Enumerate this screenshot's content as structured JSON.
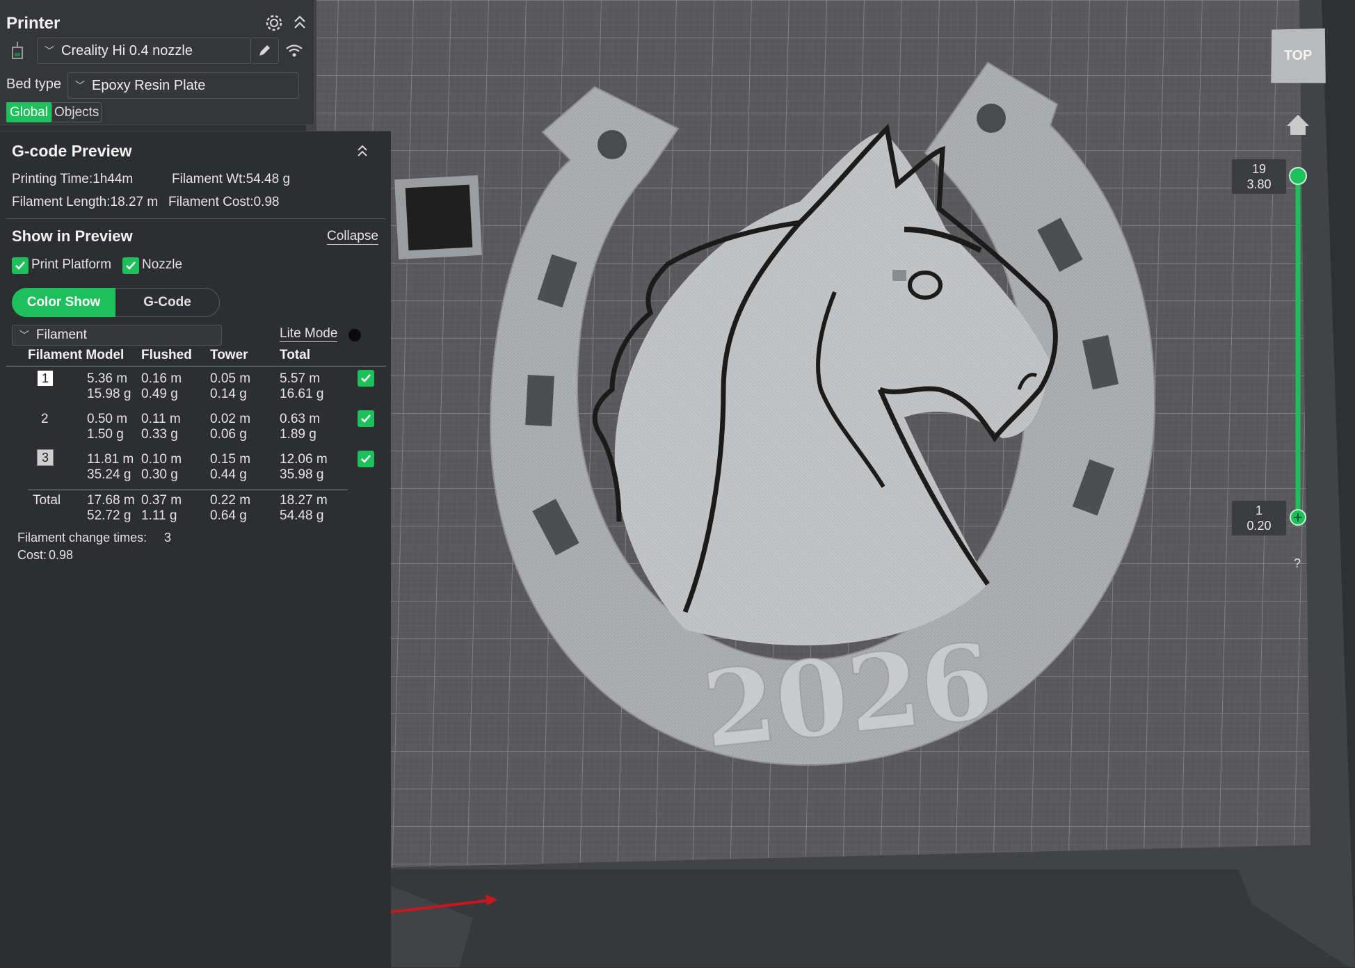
{
  "printer": {
    "title": "Printer",
    "printer_name": "Creality Hi 0.4 nozzle",
    "bed_type_label": "Bed type",
    "bed_type": "Epoxy Resin Plate",
    "tabs": [
      "Global",
      "Objects"
    ],
    "icons": [
      "printer-icon",
      "gear-icon",
      "collapse-up-icon",
      "edit-pencil-icon",
      "wifi-icon"
    ]
  },
  "gcode": {
    "title": "G-code Preview",
    "printing_time": "Printing Time:1h44m",
    "filament_wt": "Filament Wt:54.48 g",
    "filament_length": "Filament Length:18.27 m",
    "filament_cost": "Filament Cost:0.98",
    "show_in_preview": "Show in Preview",
    "collapse": "Collapse",
    "print_platform": "Print Platform",
    "nozzle": "Nozzle",
    "color_show": "Color Show",
    "gcode_tab": "G-Code",
    "filament_dropdown": "Filament",
    "lite_mode": "Lite Mode",
    "columns": [
      "Filament Model",
      "Flushed",
      "Tower",
      "Total"
    ],
    "rows": [
      {
        "id": "1",
        "model": [
          "5.36 m",
          "15.98 g"
        ],
        "flushed": [
          "0.16 m",
          "0.49 g"
        ],
        "tower": [
          "0.05 m",
          "0.14 g"
        ],
        "total": [
          "5.57 m",
          "16.61 g"
        ]
      },
      {
        "id": "2",
        "model": [
          "0.50 m",
          "1.50 g"
        ],
        "flushed": [
          "0.11 m",
          "0.33 g"
        ],
        "tower": [
          "0.02 m",
          "0.06 g"
        ],
        "total": [
          "0.63 m",
          "1.89 g"
        ]
      },
      {
        "id": "3",
        "model": [
          "11.81 m",
          "35.24 g"
        ],
        "flushed": [
          "0.10 m",
          "0.30 g"
        ],
        "tower": [
          "0.15 m",
          "0.44 g"
        ],
        "total": [
          "12.06 m",
          "35.98 g"
        ]
      }
    ],
    "total_row": {
      "label": "Total",
      "model": [
        "17.68 m",
        "52.72 g"
      ],
      "flushed": [
        "0.37 m",
        "1.11 g"
      ],
      "tower": [
        "0.22 m",
        "0.64 g"
      ],
      "total": [
        "18.27 m",
        "54.48 g"
      ]
    },
    "change_times": "Filament change times:",
    "change_times_value": "3",
    "cost_label": "Cost:",
    "cost_value": "0.98"
  },
  "viewport": {
    "model_text": "2026",
    "view_cube": "TOP",
    "layer_top": {
      "layer": "19",
      "height": "3.80"
    },
    "layer_bottom": {
      "layer": "1",
      "height": "0.20"
    },
    "help": "?",
    "accent_color": "#1ec05c"
  }
}
